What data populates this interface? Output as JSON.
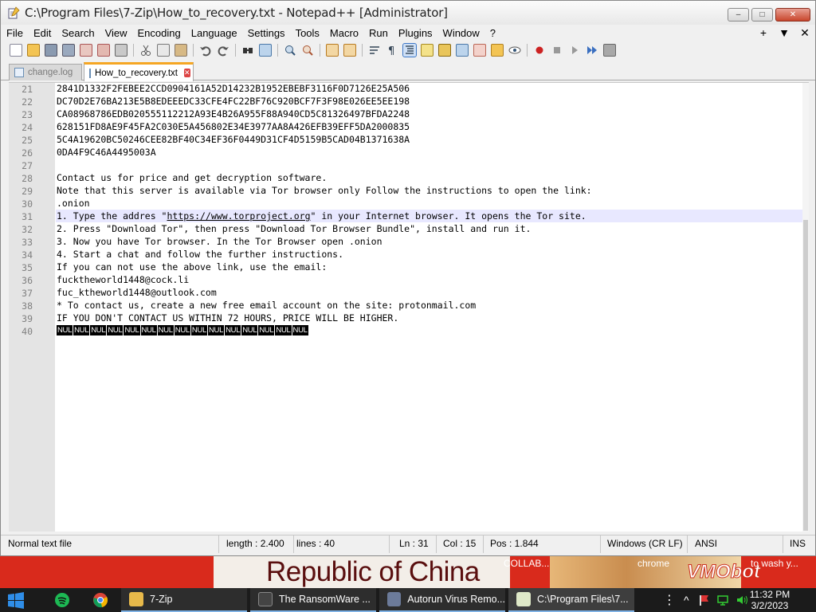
{
  "window": {
    "title": "C:\\Program Files\\7-Zip\\How_to_recovery.txt - Notepad++ [Administrator]",
    "controls": {
      "minimize": "–",
      "maximize": "□",
      "close": "✕"
    }
  },
  "menubar": {
    "items": [
      "File",
      "Edit",
      "Search",
      "View",
      "Encoding",
      "Language",
      "Settings",
      "Tools",
      "Macro",
      "Run",
      "Plugins",
      "Window",
      "?"
    ],
    "right": [
      "+",
      "▼",
      "✕"
    ]
  },
  "tabs": [
    {
      "label": "change.log",
      "active": false,
      "icon": "file-icon"
    },
    {
      "label": "How_to_recovery.txt",
      "active": true,
      "icon": "file-icon"
    }
  ],
  "editor": {
    "lines": [
      {
        "no": "21",
        "text": "2841D1332F2FEBEE2CCD0904161A52D14232B1952EBEBF3116F0D7126E25A506"
      },
      {
        "no": "22",
        "text": "DC70D2E76BA213E5B8EDEEEDC33CFE4FC22BF76C920BCF7F3F98E026EE5EE198"
      },
      {
        "no": "23",
        "text": "CA08968786EDB020555112212A93E4B26A955F88A940CD5C81326497BFDA2248"
      },
      {
        "no": "24",
        "text": "628151FD8AE9F45FA2C030E5A456802E34E3977AA8A426EFB39EFF5DA2000835"
      },
      {
        "no": "25",
        "text": "5C4A19620BC50246CEE82BF40C34EF36F0449D31CF4D5159B5CAD04B1371638A"
      },
      {
        "no": "26",
        "text": "0DA4F9C46A4495003A"
      },
      {
        "no": "27",
        "text": ""
      },
      {
        "no": "28",
        "text": "Contact us for price and get decryption software."
      },
      {
        "no": "29",
        "text": "Note that this server is available via Tor browser only Follow the instructions to open the link:"
      },
      {
        "no": "30",
        "text": ".onion"
      },
      {
        "no": "31",
        "text_before": "1. Type the addres \"",
        "link": "https://www.torproject.org",
        "text_after": "\" in your Internet browser. It opens the Tor site."
      },
      {
        "no": "32",
        "text": "2. Press \"Download Tor\", then press \"Download Tor Browser Bundle\", install and run it."
      },
      {
        "no": "33",
        "text": "3. Now you have Tor browser. In the Tor Browser open .onion"
      },
      {
        "no": "34",
        "text": "4. Start a chat and follow the further instructions."
      },
      {
        "no": "35",
        "text": "If you can not use the above link, use the email:"
      },
      {
        "no": "36",
        "text": "fucktheworld1448@cock.li"
      },
      {
        "no": "37",
        "text": "fuc_ktheworld1448@outlook.com"
      },
      {
        "no": "38",
        "text": "* To contact us, create a new free email account on the site: protonmail.com"
      },
      {
        "no": "39",
        "text": "IF YOU DON'T CONTACT US WITHIN 72 HOURS, PRICE WILL BE HIGHER."
      },
      {
        "no": "40",
        "nul": [
          "NUL",
          "NUL",
          "NUL",
          "NUL",
          "NUL",
          "NUL",
          "NUL",
          "NUL",
          "NUL",
          "NUL",
          "NUL",
          "NUL",
          "NUL",
          "NUL",
          "NUL"
        ]
      }
    ],
    "current_line": "31"
  },
  "statusbar": {
    "file_type": "Normal text file",
    "length": "length : 2.400",
    "lines": "lines : 40",
    "ln": "Ln : 31",
    "col": "Col : 15",
    "pos": "Pos : 1.844",
    "eol": "Windows (CR LF)",
    "encoding": "ANSI",
    "mode": "INS"
  },
  "desktop": {
    "banner_text": "Republic of China",
    "label_collab": "COLLAB...",
    "label_chrome": "chrome",
    "label_wash": "to wash y...",
    "brand": "VMObot"
  },
  "taskbar": {
    "items": [
      {
        "label": "7-Zip",
        "icon": "folder-icon"
      },
      {
        "label": "The RansomWare ...",
        "icon": "video-icon"
      },
      {
        "label": "Autorun Virus Remo...",
        "icon": "app-icon"
      },
      {
        "label": "C:\\Program Files\\7...",
        "icon": "notepad-icon"
      }
    ],
    "time": "11:32 PM",
    "date": "3/2/2023"
  },
  "colors": {
    "accent_tab": "#f5a623",
    "taskbar": "#1b1b1b",
    "current_line": "#e8e8ff"
  }
}
